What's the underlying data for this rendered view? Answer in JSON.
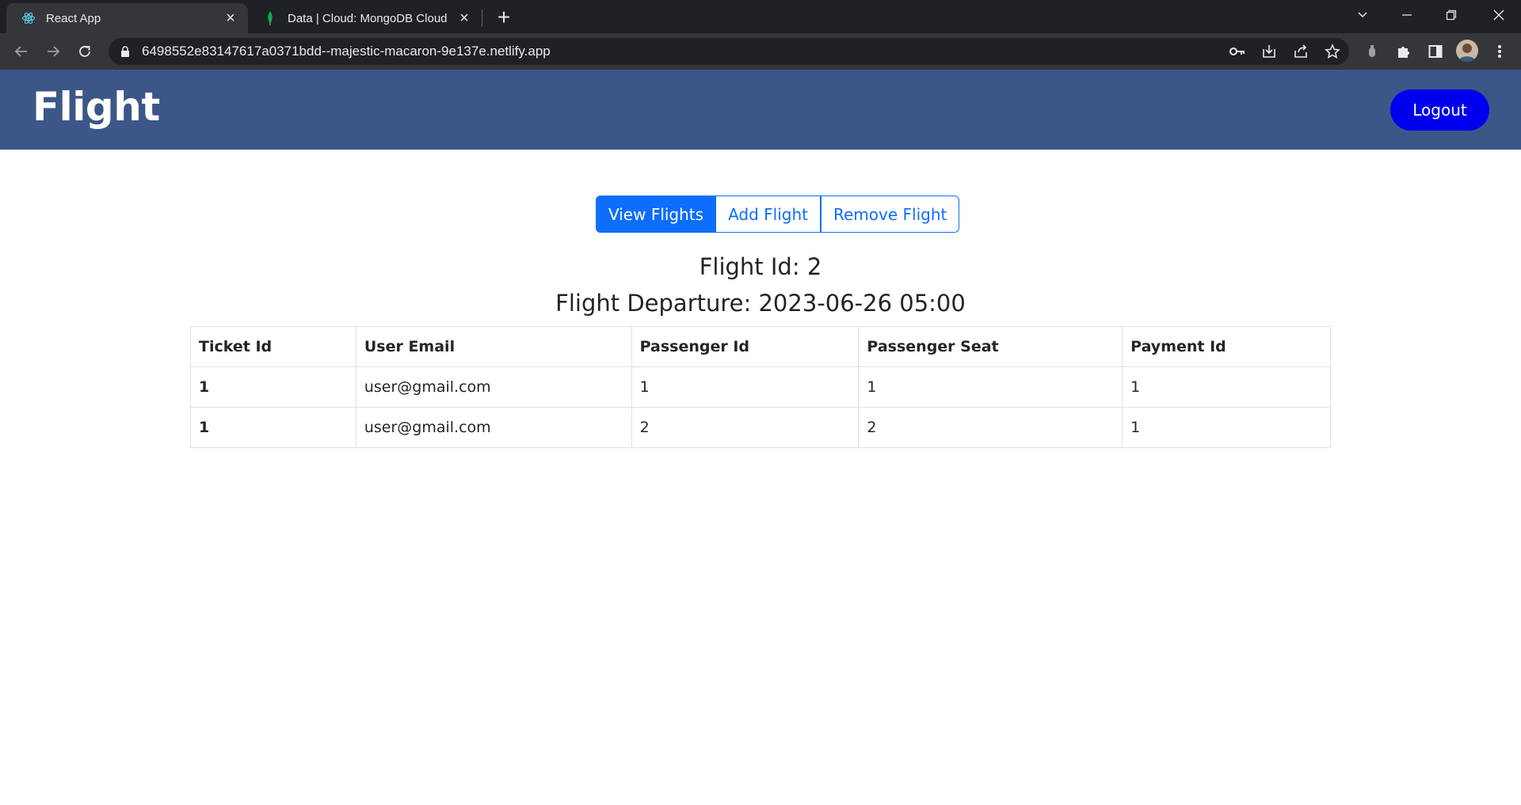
{
  "browser": {
    "tabs": [
      {
        "title": "React App",
        "active": true,
        "icon": "react-icon"
      },
      {
        "title": "Data | Cloud: MongoDB Cloud",
        "active": false,
        "icon": "mongodb-leaf-icon"
      }
    ],
    "url": "6498552e83147617a0371bdd--majestic-macaron-9e137e.netlify.app"
  },
  "header": {
    "brand": "Flight",
    "logout_label": "Logout",
    "background": "#3b5788",
    "logout_color": "#0000ee"
  },
  "actions": {
    "view_flights": "View Flights",
    "add_flight": "Add Flight",
    "remove_flight": "Remove Flight",
    "accent": "#0d6efd"
  },
  "flight": {
    "id_line": "Flight Id: 2",
    "departure_line": "Flight Departure: 2023-06-26 05:00"
  },
  "table": {
    "columns": [
      "Ticket Id",
      "User Email",
      "Passenger Id",
      "Passenger Seat",
      "Payment Id"
    ],
    "rows": [
      [
        "1",
        "user@gmail.com",
        "1",
        "1",
        "1"
      ],
      [
        "1",
        "user@gmail.com",
        "2",
        "2",
        "1"
      ]
    ]
  }
}
